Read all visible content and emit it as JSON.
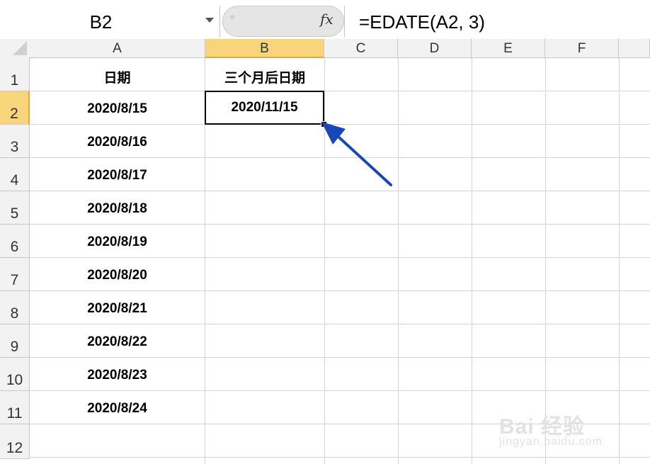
{
  "formula_bar": {
    "name_box": "B2",
    "fx_label": "fx",
    "formula": "=EDATE(A2, 3)"
  },
  "columns": [
    "A",
    "B",
    "C",
    "D",
    "E",
    "F"
  ],
  "selected_column": "B",
  "rows": [
    "1",
    "2",
    "3",
    "4",
    "5",
    "6",
    "7",
    "8",
    "9",
    "10",
    "11",
    "12"
  ],
  "selected_row": "2",
  "cells": {
    "A1": "日期",
    "B1": "三个月后日期",
    "A2": "2020/8/15",
    "B2": "2020/11/15",
    "A3": "2020/8/16",
    "A4": "2020/8/17",
    "A5": "2020/8/18",
    "A6": "2020/8/19",
    "A7": "2020/8/20",
    "A8": "2020/8/21",
    "A9": "2020/8/22",
    "A10": "2020/8/23",
    "A11": "2020/8/24"
  },
  "annotation_arrow_color": "#1a47b8",
  "selection_header_color": "#f8d57a",
  "watermark": {
    "brand": "Bai 经验",
    "url": "jingyan.baidu.com"
  }
}
